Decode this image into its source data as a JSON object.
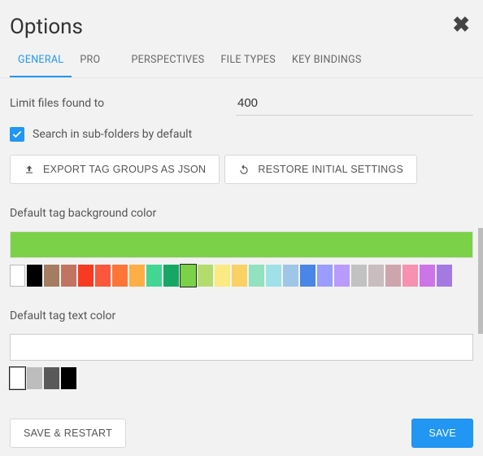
{
  "title": "Options",
  "tabs": [
    {
      "label": "GENERAL",
      "active": true
    },
    {
      "label": "PRO",
      "active": false
    },
    {
      "label": "PERSPECTIVES",
      "active": false
    },
    {
      "label": "FILE TYPES",
      "active": false
    },
    {
      "label": "KEY BINDINGS",
      "active": false
    }
  ],
  "limit": {
    "label": "Limit files found to",
    "value": "400"
  },
  "search_subfolders": {
    "label": "Search in sub-folders by default",
    "checked": true
  },
  "buttons": {
    "export_json": "EXPORT TAG GROUPS AS JSON",
    "restore": "RESTORE INITIAL SETTINGS",
    "save_restart": "SAVE & RESTART",
    "save": "SAVE"
  },
  "bg_color": {
    "label": "Default tag background color",
    "value": "#7bd148",
    "swatches": [
      "#ffffff",
      "#000000",
      "#a47c62",
      "#c17461",
      "#f83a22",
      "#fa573c",
      "#ff7537",
      "#ffad46",
      "#42d692",
      "#16a765",
      "#7bd148",
      "#b3dc6c",
      "#fbe983",
      "#fad165",
      "#92e1c0",
      "#9fe1e7",
      "#9fc6e7",
      "#4986e7",
      "#9a9cff",
      "#b99aff",
      "#c2c2c2",
      "#cabdbf",
      "#cca6ac",
      "#f691b2",
      "#cd74e6",
      "#a47ae2"
    ]
  },
  "text_color": {
    "label": "Default tag text color",
    "value": "#ffffff",
    "swatches": [
      "#ffffff",
      "#bdbdbd",
      "#595959",
      "#000000"
    ]
  }
}
